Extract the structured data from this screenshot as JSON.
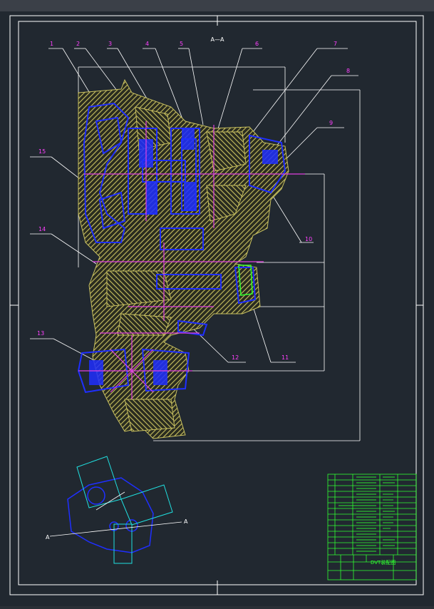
{
  "view_label": "A—A",
  "section_marks": [
    "A",
    "A"
  ],
  "part_numbers": [
    "1",
    "2",
    "3",
    "4",
    "5",
    "6",
    "7",
    "8",
    "9",
    "10",
    "11",
    "12",
    "13",
    "14",
    "15"
  ],
  "title_block": {
    "drawing_title": "DVT装配图"
  },
  "colors": {
    "background": "#212830",
    "frame": "#ffffff",
    "hatch_yellow": "#c8c060",
    "parts_blue": "#1f2fff",
    "centerline_magenta": "#e040e0",
    "leader_white": "#ffffff",
    "title_green": "#30ff30",
    "cyan": "#20e0e0",
    "label_magenta": "#ff40ff"
  }
}
